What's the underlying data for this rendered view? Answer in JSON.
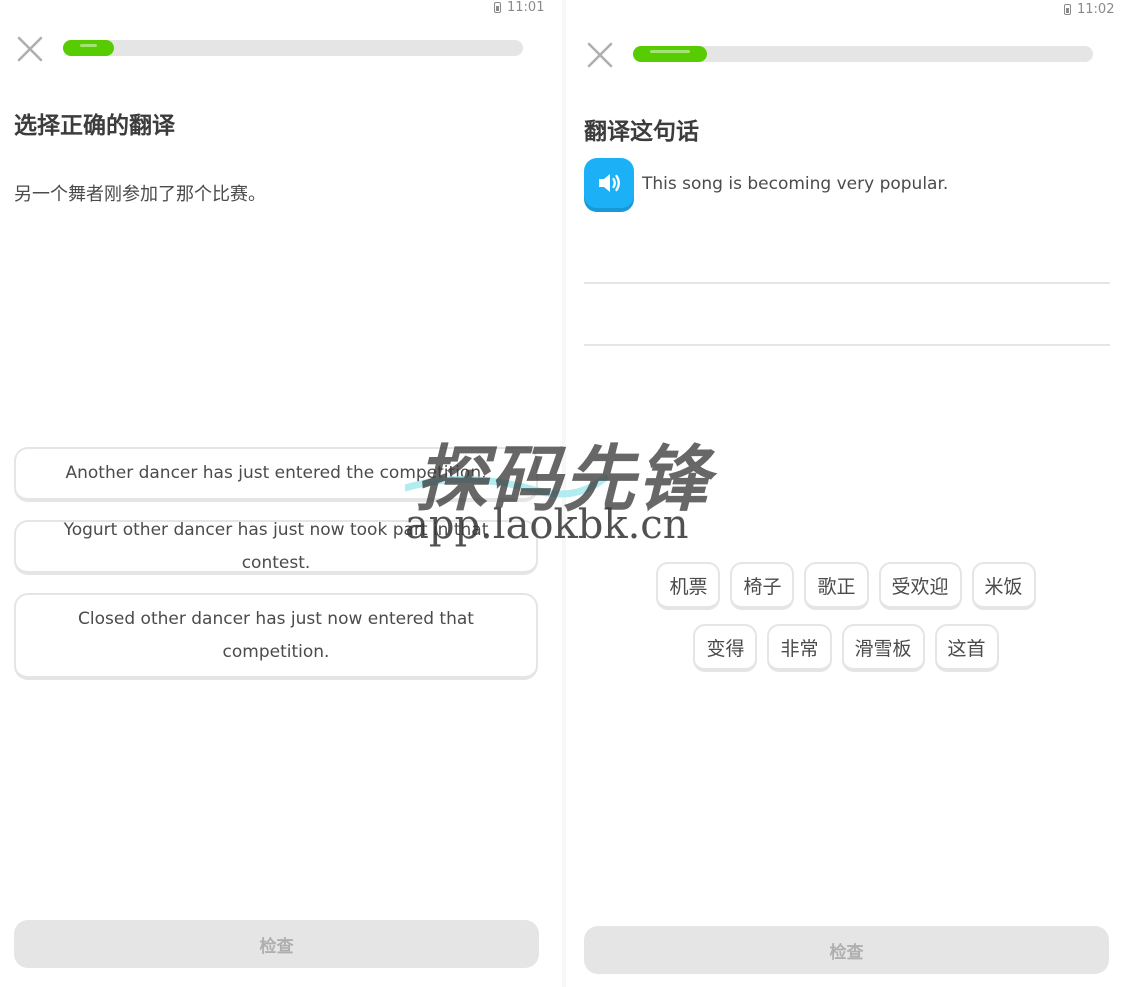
{
  "left_screen": {
    "status": {
      "time": "11:01"
    },
    "progress": {
      "fraction": 0.11
    },
    "title": "选择正确的翻译",
    "sentence": "另一个舞者刚参加了那个比赛。",
    "choices": [
      {
        "text": "Another dancer has just entered the competition."
      },
      {
        "text": "Yogurt other dancer has just now took part in that contest."
      },
      {
        "text": "Closed other dancer has just now entered that competition."
      }
    ],
    "check_label": "检查"
  },
  "right_screen": {
    "status": {
      "time": "11:02"
    },
    "progress": {
      "fraction": 0.16
    },
    "title": "翻译这句话",
    "audio_icon": "speaker-icon",
    "sentence": "This song is becoming very popular.",
    "word_bank": [
      [
        "机票",
        "椅子",
        "歌正",
        "受欢迎",
        "米饭"
      ],
      [
        "变得",
        "非常",
        "滑雪板",
        "这首"
      ]
    ],
    "check_label": "检查"
  },
  "watermark": {
    "title": "探码先锋",
    "url": "app.laokbk.cn"
  },
  "colors": {
    "progress_green": "#58cc02",
    "track_gray": "#e5e5e5",
    "speaker_blue": "#1cb0f6",
    "disabled_text": "#afafaf"
  }
}
